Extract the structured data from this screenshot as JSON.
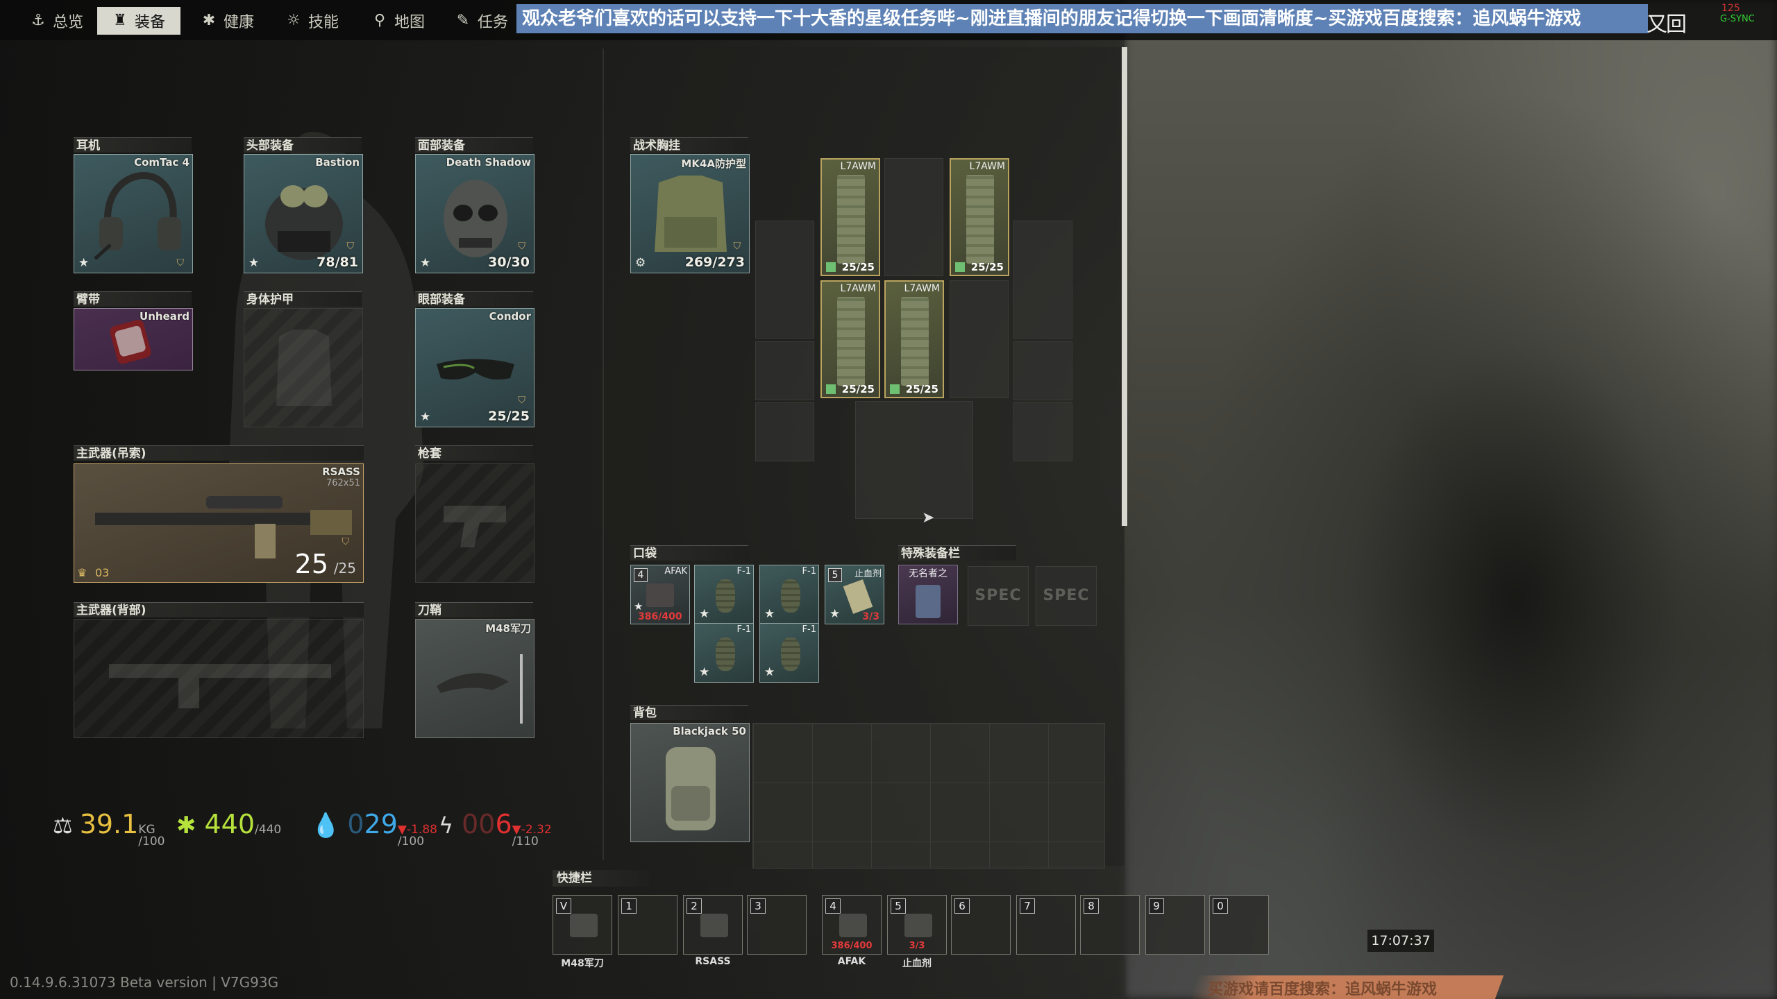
{
  "nav": {
    "tabs": [
      {
        "label": "总览",
        "icon": "anchor-icon"
      },
      {
        "label": "装备",
        "icon": "gear-bag-icon"
      },
      {
        "label": "健康",
        "icon": "health-icon"
      },
      {
        "label": "技能",
        "icon": "skills-icon"
      },
      {
        "label": "地图",
        "icon": "map-pin-icon"
      },
      {
        "label": "任务",
        "icon": "task-icon"
      }
    ],
    "active_tab": "装备"
  },
  "banner": "观众老爷们喜欢的话可以支持一下十大香的星级任务哔~刚进直播间的朋友记得切换一下画面清晰度~买游戏百度搜索：追风蜗牛游戏",
  "window_controls": [
    "又",
    "回"
  ],
  "overlay": {
    "fps": "125",
    "gsync": "G-SYNC"
  },
  "equipment": {
    "earpiece": {
      "label": "耳机",
      "item": "ComTac 4"
    },
    "headwear": {
      "label": "头部装备",
      "item": "Bastion",
      "durability": "78/81"
    },
    "face_cover": {
      "label": "面部装备",
      "item": "Death Shadow",
      "durability": "30/30"
    },
    "armband": {
      "label": "臂带",
      "item": "Unheard"
    },
    "body_armor": {
      "label": "身体护甲"
    },
    "eyewear": {
      "label": "眼部装备",
      "item": "Condor",
      "durability": "25/25"
    },
    "primary_sling": {
      "label": "主武器(吊索)",
      "item": "RSASS",
      "caliber": "762x51",
      "ammo": "25",
      "ammo_max": "/25",
      "rank": "03"
    },
    "holster": {
      "label": "枪套"
    },
    "primary_back": {
      "label": "主武器(背部)"
    },
    "scabbard": {
      "label": "刀鞘",
      "item": "M48军刀"
    }
  },
  "rig": {
    "label": "战术胸挂",
    "item": "MK4A防护型",
    "durability": "269/273",
    "mags": [
      {
        "name": "L7AWM",
        "count": "25/25"
      },
      {
        "name": "L7AWM",
        "count": "25/25"
      },
      {
        "name": "L7AWM",
        "count": "25/25"
      },
      {
        "name": "L7AWM",
        "count": "25/25"
      }
    ]
  },
  "pockets": {
    "label": "口袋",
    "items": [
      {
        "slot": "4",
        "name": "AFAK",
        "value": "386/400"
      },
      {
        "name": "F-1"
      },
      {
        "name": "F-1"
      },
      {
        "slot": "5",
        "name": "止血剂",
        "value": "3/3"
      },
      {
        "name": "F-1"
      },
      {
        "name": "F-1"
      }
    ]
  },
  "special": {
    "label": "特殊装备栏",
    "item": "无名者之",
    "empty_slots": [
      "SPEC",
      "SPEC"
    ]
  },
  "backpack": {
    "label": "背包",
    "item": "Blackjack 50"
  },
  "stats": {
    "weight": {
      "value": "39.1",
      "unit": "KG",
      "max": "/100"
    },
    "health": {
      "value": "440",
      "max": "/440"
    },
    "hydration": {
      "prefix": "0",
      "value": "29",
      "max": "/100",
      "rate": "▼-1.88"
    },
    "energy": {
      "prefix": "00",
      "value": "6",
      "max": "/110",
      "rate": "▼-2.32"
    }
  },
  "hotbar": {
    "label": "快捷栏",
    "slots": [
      {
        "key": "V",
        "caption": "M48军刀"
      },
      {
        "key": "1",
        "caption": ""
      },
      {
        "key": "2",
        "caption": "RSASS"
      },
      {
        "key": "3",
        "caption": ""
      },
      {
        "key": "4",
        "caption": "AFAK",
        "value": "386/400"
      },
      {
        "key": "5",
        "caption": "止血剂",
        "value": "3/3"
      },
      {
        "key": "6",
        "caption": ""
      },
      {
        "key": "7",
        "caption": ""
      },
      {
        "key": "8",
        "caption": ""
      },
      {
        "key": "9",
        "caption": ""
      },
      {
        "key": "0",
        "caption": ""
      }
    ]
  },
  "clock": "17:07:37",
  "version": "0.14.9.6.31073 Beta version | V7G93G",
  "ad_footer": "买游戏请百度搜索：追风蜗牛游戏",
  "colors": {
    "banner": "#5e82b5",
    "weight": "#e8c040",
    "health": "#b6e23c",
    "hydration": "#3fa8e8",
    "warning": "#e03030"
  }
}
